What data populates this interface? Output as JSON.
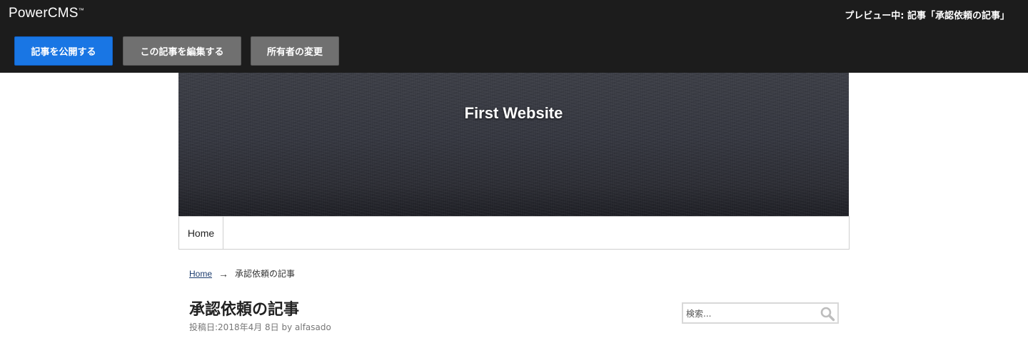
{
  "toolbar": {
    "logo": "PowerCMS",
    "logo_mark": "™",
    "preview_status": "プレビュー中: 記事「承認依頼の記事」",
    "publish_label": "記事を公開する",
    "edit_label": "この記事を編集する",
    "owner_label": "所有者の変更"
  },
  "site": {
    "title": "First Website"
  },
  "nav": {
    "items": [
      {
        "label": "Home"
      }
    ]
  },
  "breadcrumb": {
    "home": "Home",
    "separator": "→",
    "current": "承認依頼の記事"
  },
  "post": {
    "title": "承認依頼の記事",
    "meta": "投稿日:2018年4月 8日 by alfasado"
  },
  "search": {
    "placeholder": "検索...",
    "icon": "search-icon"
  },
  "colors": {
    "toolbar_bg": "#1c1c1c",
    "publish_button": "#1976e4",
    "secondary_button": "#707070",
    "link": "#1a3b6e"
  }
}
